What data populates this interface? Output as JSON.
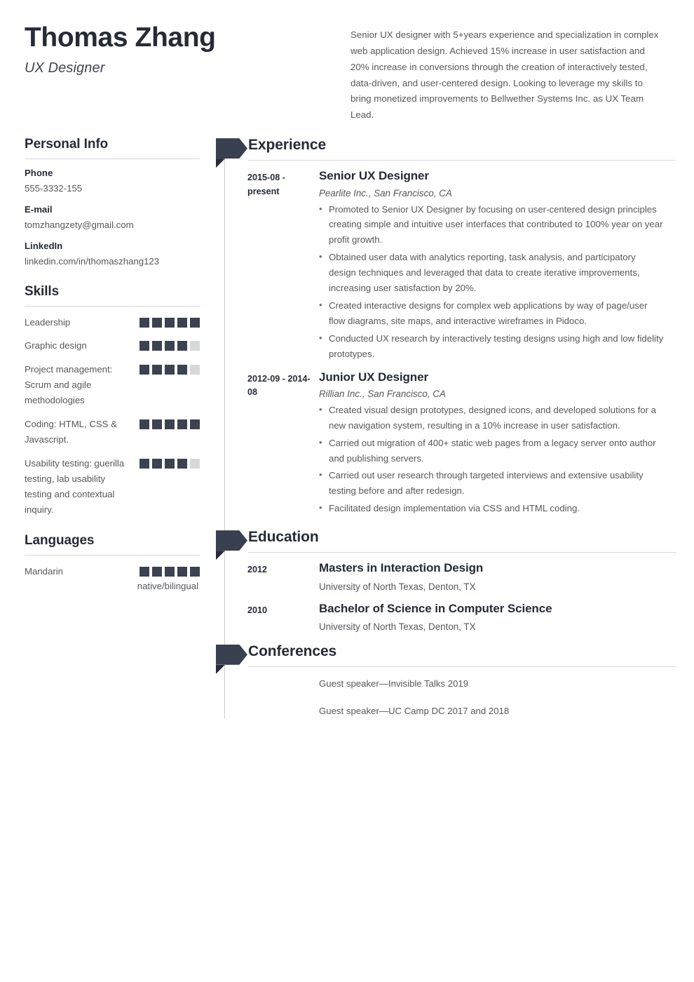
{
  "header": {
    "name": "Thomas Zhang",
    "job_title": "UX Designer",
    "summary": "Senior UX designer with 5+years experience and specialization in complex web application design. Achieved 15% increase in user satisfaction and 20% increase in conversions through the creation of interactively tested, data-driven, and user-centered design. Looking to leverage my skills to bring monetized improvements to Bellwether Systems Inc. as UX Team Lead."
  },
  "sidebar": {
    "personal_info": {
      "heading": "Personal Info",
      "fields": [
        {
          "label": "Phone",
          "value": "555-3332-155"
        },
        {
          "label": "E-mail",
          "value": "tomzhangzety@gmail.com"
        },
        {
          "label": "LinkedIn",
          "value": "linkedin.com/in/thomaszhang123"
        }
      ]
    },
    "skills": {
      "heading": "Skills",
      "max_level": 5,
      "items": [
        {
          "name": "Leadership",
          "level": 5
        },
        {
          "name": "Graphic design",
          "level": 4
        },
        {
          "name": "Project management: Scrum and agile methodologies",
          "level": 4
        },
        {
          "name": "Coding: HTML, CSS & Javascript.",
          "level": 5
        },
        {
          "name": "Usability testing: guerilla testing, lab usability testing and contextual inquiry.",
          "level": 4
        }
      ]
    },
    "languages": {
      "heading": "Languages",
      "max_level": 5,
      "items": [
        {
          "name": "Mandarin",
          "level": 5,
          "note": "native/bilingual"
        }
      ]
    }
  },
  "main": {
    "experience": {
      "heading": "Experience",
      "entries": [
        {
          "date": "2015-08 - present",
          "title": "Senior UX Designer",
          "subtitle": "Pearlite Inc., San Francisco, CA",
          "bullets": [
            "Promoted to Senior UX Designer by focusing on user-centered design principles creating simple and intuitive user interfaces that contributed to 100% year on year profit growth.",
            "Obtained user data with analytics reporting, task analysis, and participatory design techniques and leveraged that data to create iterative improvements, increasing user satisfaction by 20%.",
            "Created interactive designs for complex web applications by way of page/user flow diagrams, site maps, and interactive wireframes in Pidoco.",
            "Conducted UX research by interactively testing designs using high and low fidelity prototypes."
          ]
        },
        {
          "date": "2012-09 - 2014-08",
          "title": "Junior UX Designer",
          "subtitle": "Rillian Inc., San Francisco, CA",
          "bullets": [
            "Created visual design prototypes, designed icons, and developed solutions for a new navigation system, resulting in a 10% increase in user satisfaction.",
            "Carried out migration of 400+ static web pages from a legacy server onto author and publishing servers.",
            "Carried out user research through targeted interviews and extensive usability testing before and after redesign.",
            "Facilitated design implementation via CSS and HTML coding."
          ]
        }
      ]
    },
    "education": {
      "heading": "Education",
      "entries": [
        {
          "date": "2012",
          "title": "Masters in Interaction Design",
          "subtitle": "University of North Texas, Denton, TX"
        },
        {
          "date": "2010",
          "title": "Bachelor of Science in Computer Science",
          "subtitle": "University of North Texas, Denton, TX"
        }
      ]
    },
    "conferences": {
      "heading": "Conferences",
      "items": [
        "Guest speaker—Invisible Talks 2019",
        "Guest speaker—UC Camp DC 2017 and 2018"
      ]
    }
  },
  "colors": {
    "ink": "#262b36",
    "body": "#56585c",
    "ribbon": "#39404f",
    "ribbon_fold": "#252b3a",
    "dot_on": "#3b4251",
    "dot_off": "#d6d8da",
    "rule": "#d8d8d8"
  }
}
